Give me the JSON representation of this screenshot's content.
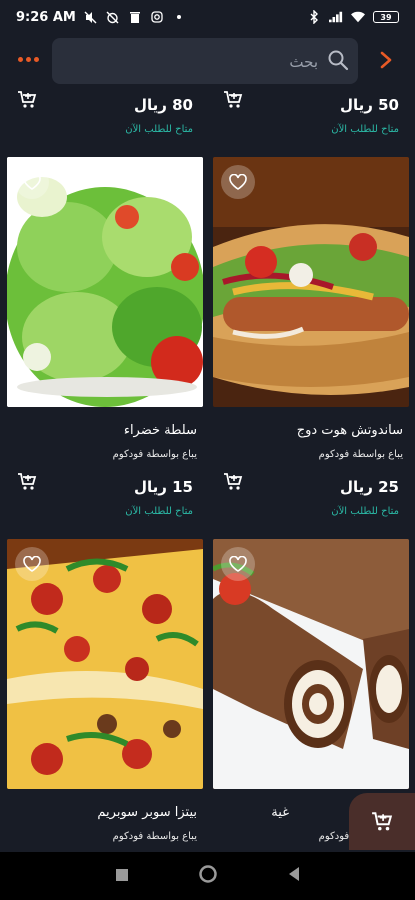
{
  "status_bar": {
    "time": "9:26 AM",
    "battery": "39",
    "icons": [
      "mute-icon",
      "alarm-off-icon",
      "trash-icon",
      "instagram-icon",
      "dot-icon",
      "bluetooth-icon",
      "signal-icon",
      "wifi-icon"
    ]
  },
  "header": {
    "search_placeholder": "بحث",
    "menu_icon": "more-dots-icon",
    "back_icon": "chevron-right-icon"
  },
  "colors": {
    "accent": "#e85a26",
    "available": "#2bb9a6",
    "background": "#181c26",
    "search_bg": "#2a2f3b"
  },
  "products": [
    {
      "price": "50 ريال",
      "availability": "متاح للطلب الآن",
      "name": "ساندوتش هوت دوج",
      "seller": "يباع بواسطة فودكوم"
    },
    {
      "price": "80 ريال",
      "availability": "متاح للطلب الآن",
      "name": "سلطة خضراء",
      "seller": "يباع بواسطة فودكوم"
    },
    {
      "price": "25 ريال",
      "availability": "متاح للطلب الآن",
      "name": "غية",
      "seller": "يباع بواسطة فودكوم"
    },
    {
      "price": "15 ريال",
      "availability": "متاح للطلب الآن",
      "name": "بيتزا سوبر سوبريم",
      "seller": "يباع بواسطة فودكوم"
    }
  ]
}
